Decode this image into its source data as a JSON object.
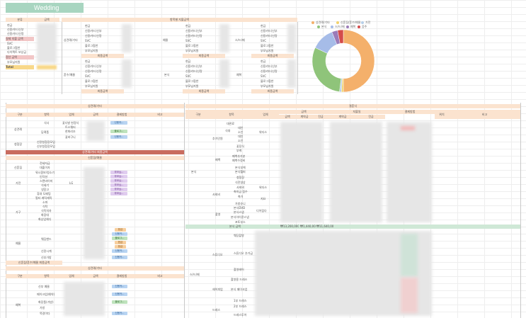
{
  "title": "Wedding",
  "summary": {
    "header_category": "분류",
    "header_amount": "금액",
    "rows": [
      "현금",
      "신용카드(신부",
      "신용카드(신랑",
      "실제 지불 금액",
      "SVC",
      "블로그협찬",
      "다이렉트 보상금",
      "정산 금액",
      "부모님지원",
      "Total"
    ]
  },
  "regional": {
    "title": "항목별 지불금액",
    "blocks": [
      {
        "name": "상견례/기타",
        "total": "최종금액"
      },
      {
        "name": "예물",
        "total": "최종금액"
      },
      {
        "name": "스/드/메",
        "total": "최종금액"
      },
      {
        "name": "혼수/예물",
        "total": "최종금액"
      },
      {
        "name": "본식",
        "total": "최종금액"
      },
      {
        "name": "예복",
        "total": "최종금액"
      }
    ],
    "payment_rows": [
      "현금",
      "신용카드(신부",
      "신용카드(신랑",
      "SVC",
      "블로그협찬",
      "부모님지원"
    ]
  },
  "chart": {
    "legend": [
      "상견례/기타",
      "신혼집/혼수/예물",
      "가전",
      "본식",
      "스/드/메",
      "예복",
      "음주"
    ],
    "colors": [
      "#f4b06b",
      "#f2d36b",
      "#b6cfe9",
      "#8fc47a",
      "#a6bce8",
      "#9b7bb8",
      "#d44b4b"
    ],
    "chart_data": {
      "type": "pie",
      "categories": [
        "상견례/기타",
        "신혼집/혼수/예물",
        "가전",
        "본식",
        "스/드/메",
        "예복",
        "음주"
      ],
      "values": [
        50,
        1,
        1,
        30,
        12,
        3,
        3
      ]
    }
  },
  "left_table": {
    "section_title": "상견례/기타",
    "columns": [
      "구분",
      "항목",
      "업체",
      "금액",
      "결제방법",
      "비고"
    ],
    "groups": [
      {
        "name": "상견례",
        "items": [
          "식사",
          "답례품"
        ]
      },
      {
        "name": "청첩장",
        "items": [
          "신랑청첩장모임",
          "신부청첩장모임"
        ]
      }
    ],
    "subitems_gift": [
      "꽃다발 헌정식",
      "트스웨터",
      "한화리조",
      "꽃바구니"
    ],
    "total_label": "상견례/기타 최종금액",
    "section2_title": "신혼집/예물",
    "groups2": [
      {
        "name": "신혼집",
        "items": [
          "전세자금",
          "대출이자"
        ]
      },
      {
        "name": "가전",
        "items": [
          "워시콤보/청소기",
          "인덕션",
          "스탠바이미",
          "식세기",
          "냉장고",
          "휴대 도배팅",
          "필터 캐릭캐릭"
        ],
        "vendor": "LG"
      },
      {
        "name": "가구",
        "items": [
          "소파",
          "식탁",
          "식탁의자",
          "화장대",
          "화상업체다"
        ]
      },
      {
        "name": "예물",
        "items": [
          "웨딩밴드",
          "신랑시계",
          "신부가방"
        ]
      }
    ],
    "total2_label": "신혼집/혼수/예물 최종금액",
    "section3_title": "상견례/기타",
    "group3": {
      "name": "예복",
      "items": [
        "신부 예물",
        "메이크업(예약)",
        "화장품(가방)",
        "가방",
        "목걸이다"
      ]
    }
  },
  "right_table": {
    "section_title": "결혼식",
    "columns": [
      "구분",
      "항목",
      "업체",
      "금액",
      "지불일",
      "결제방법",
      "위치",
      "비고"
    ],
    "subcolumns": [
      "금액",
      "계약금",
      "잔금",
      "계약금",
      "잔금"
    ],
    "groups": [
      {
        "name": "식대",
        "items": [
          "대관료",
          "대인",
          "소인",
          "대인",
          "소인"
        ]
      },
      {
        "name": "추가인원",
        "items": [
          "소인"
        ]
      },
      {
        "name": "폐백",
        "items": [
          "폐백추가분",
          "폐백수정비"
        ]
      },
      {
        "name": "사회비",
        "items": [
          "사회비",
          "축의금 접수",
          "축가"
        ]
      },
      {
        "name": "촬영",
        "items": [
          "본식DVD",
          "본식스냅",
          "본식아이폰스냅",
          "포토부스"
        ]
      }
    ],
    "vendor_1": "위더스",
    "vendor_2": "지요",
    "vendor_3": "디어립다",
    "misc_items": [
      "꽃장식",
      "부케",
      "본식부케",
      "본식헬퍼",
      "청첩장",
      "식전영상",
      "가방슈니",
      "축가"
    ],
    "category": "본식",
    "total_label": "본식 금액",
    "total_values": [
      "₩13,200,000",
      "₩1,440,000",
      "₩11,640,000"
    ],
    "section2_category": "스/드/메",
    "section2_groups": [
      {
        "name": "스튜디오",
        "items": [
          "웨딩촬영",
          "스튜디오 추가금"
        ]
      },
      {
        "name": "헤어피업",
        "items": [
          "촬영헤어",
          "본식 메이크업"
        ]
      },
      {
        "name": "드레스",
        "items": [
          "촬영용 드레스",
          "1부 드레스",
          "2부 드레스",
          "드레스투어"
        ]
      }
    ]
  }
}
